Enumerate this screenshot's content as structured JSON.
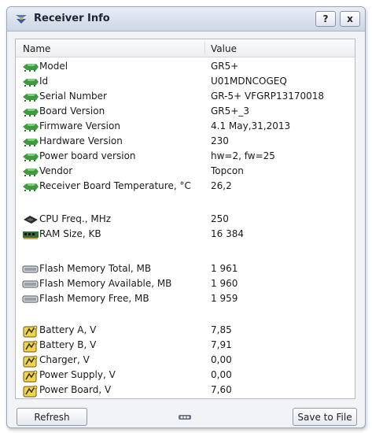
{
  "window": {
    "title": "Receiver Info"
  },
  "titlebar": {
    "help_label": "?",
    "close_label": "x"
  },
  "table": {
    "columns": {
      "name": "Name",
      "value": "Value"
    },
    "rows": [
      {
        "name": "Model",
        "value": "GR5+",
        "icon": "green-chip-icon"
      },
      {
        "name": "Id",
        "value": "U01MDNCOGEQ",
        "icon": "green-chip-icon"
      },
      {
        "name": "Serial Number",
        "value": "GR-5+ VFGRP13170018",
        "icon": "green-chip-icon"
      },
      {
        "name": "Board Version",
        "value": "GR5+_3",
        "icon": "green-chip-icon"
      },
      {
        "name": "Firmware Version",
        "value": "4.1 May,31,2013",
        "icon": "green-chip-icon"
      },
      {
        "name": "Hardware Version",
        "value": "230",
        "icon": "green-chip-icon"
      },
      {
        "name": "Power board version",
        "value": "hw=2, fw=25",
        "icon": "green-chip-icon"
      },
      {
        "name": "Vendor",
        "value": "Topcon",
        "icon": "green-chip-icon"
      },
      {
        "name": "Receiver Board Temperature, °C",
        "value": "26,2",
        "icon": "green-chip-icon"
      },
      {
        "name": "CPU Freq., MHz",
        "value": "250",
        "icon": "cpu-icon"
      },
      {
        "name": "RAM Size, KB",
        "value": "16 384",
        "icon": "ram-icon"
      },
      {
        "name": "Flash Memory Total, MB",
        "value": "1 961",
        "icon": "flash-memory-icon"
      },
      {
        "name": "Flash Memory Available, MB",
        "value": "1 960",
        "icon": "flash-memory-icon"
      },
      {
        "name": "Flash Memory Free, MB",
        "value": "1 959",
        "icon": "flash-memory-icon"
      },
      {
        "name": "Battery A, V",
        "value": "7,85",
        "icon": "power-icon"
      },
      {
        "name": "Battery B, V",
        "value": "7,91",
        "icon": "power-icon"
      },
      {
        "name": "Charger, V",
        "value": "0,00",
        "icon": "power-icon"
      },
      {
        "name": "Power Supply, V",
        "value": "0,00",
        "icon": "power-icon"
      },
      {
        "name": "Power Board, V",
        "value": "7,60",
        "icon": "power-icon"
      }
    ]
  },
  "footer": {
    "refresh_label": "Refresh",
    "save_label": "Save to File"
  }
}
